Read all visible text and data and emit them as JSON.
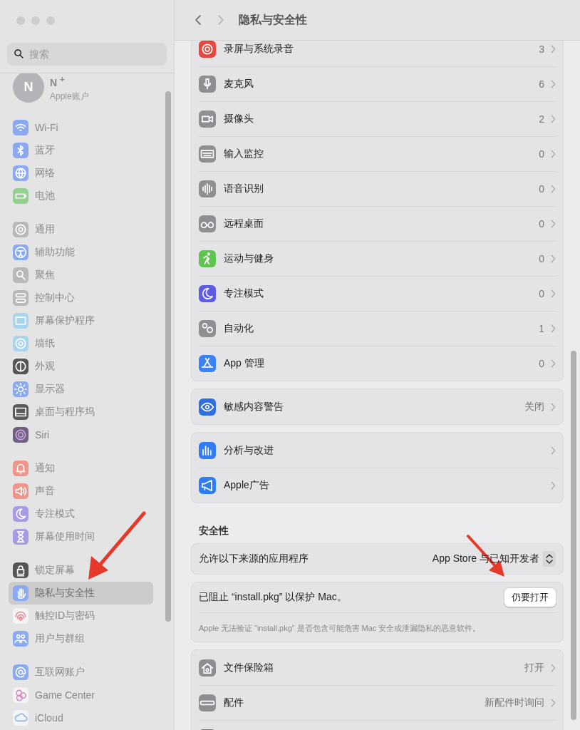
{
  "window": {
    "title": "隐私与安全性"
  },
  "sidebar": {
    "search": {
      "placeholder": "搜索"
    },
    "account": {
      "initial": "N",
      "name": "N $^{+}$",
      "subtitle": "Apple账户"
    },
    "groups": [
      [
        {
          "label": "Wi-Fi",
          "selected": false
        },
        {
          "label": "蓝牙",
          "selected": false
        },
        {
          "label": "网络",
          "selected": false
        },
        {
          "label": "电池",
          "selected": false
        }
      ],
      [
        {
          "label": "通用",
          "selected": false
        },
        {
          "label": "辅助功能",
          "selected": false
        },
        {
          "label": "聚焦",
          "selected": false
        },
        {
          "label": "控制中心",
          "selected": false
        },
        {
          "label": "屏幕保护程序",
          "selected": false
        },
        {
          "label": "墙纸",
          "selected": false
        },
        {
          "label": "外观",
          "selected": false
        },
        {
          "label": "显示器",
          "selected": false
        },
        {
          "label": "桌面与程序坞",
          "selected": false
        },
        {
          "label": "Siri",
          "selected": false
        }
      ],
      [
        {
          "label": "通知",
          "selected": false
        },
        {
          "label": "声音",
          "selected": false
        },
        {
          "label": "专注模式",
          "selected": false
        },
        {
          "label": "屏幕使用时间",
          "selected": false
        }
      ],
      [
        {
          "label": "锁定屏幕",
          "selected": false
        },
        {
          "label": "隐私与安全性",
          "selected": true
        },
        {
          "label": "触控ID与密码",
          "selected": false
        },
        {
          "label": "用户与群组",
          "selected": false
        }
      ],
      [
        {
          "label": "互联网账户",
          "selected": false
        },
        {
          "label": "Game Center",
          "selected": false
        },
        {
          "label": "iCloud",
          "selected": false
        }
      ]
    ]
  },
  "privacy_cards": [
    {
      "rows": [
        {
          "label": "录屏与系统录音",
          "value": "3"
        },
        {
          "label": "麦克风",
          "value": "6"
        },
        {
          "label": "摄像头",
          "value": "2"
        },
        {
          "label": "输入监控",
          "value": "0"
        },
        {
          "label": "语音识别",
          "value": "0"
        },
        {
          "label": "远程桌面",
          "value": "0"
        },
        {
          "label": "运动与健身",
          "value": "0"
        },
        {
          "label": "专注模式",
          "value": "0"
        },
        {
          "label": "自动化",
          "value": "1"
        },
        {
          "label": "App 管理",
          "value": "0"
        }
      ]
    },
    {
      "rows": [
        {
          "label": "敏感内容警告",
          "value": "关闭"
        }
      ]
    },
    {
      "rows": [
        {
          "label": "分析与改进"
        },
        {
          "label": "Apple广告"
        }
      ]
    }
  ],
  "security": {
    "heading": "安全性",
    "source": {
      "label": "允许以下来源的应用程序",
      "value": "App Store 与已知开发者"
    },
    "blocked": {
      "message": "已阻止 “install.pkg” 以保护 Mac。",
      "button": "仍要打开",
      "detail": "Apple 无法验证 “install.pkg” 是否包含可能危害 Mac 安全或泄漏隐私的恶意软件。"
    },
    "rows": [
      {
        "label": "文件保险箱",
        "value": "打开"
      },
      {
        "label": "配件",
        "value": "新配件时询问"
      }
    ]
  }
}
